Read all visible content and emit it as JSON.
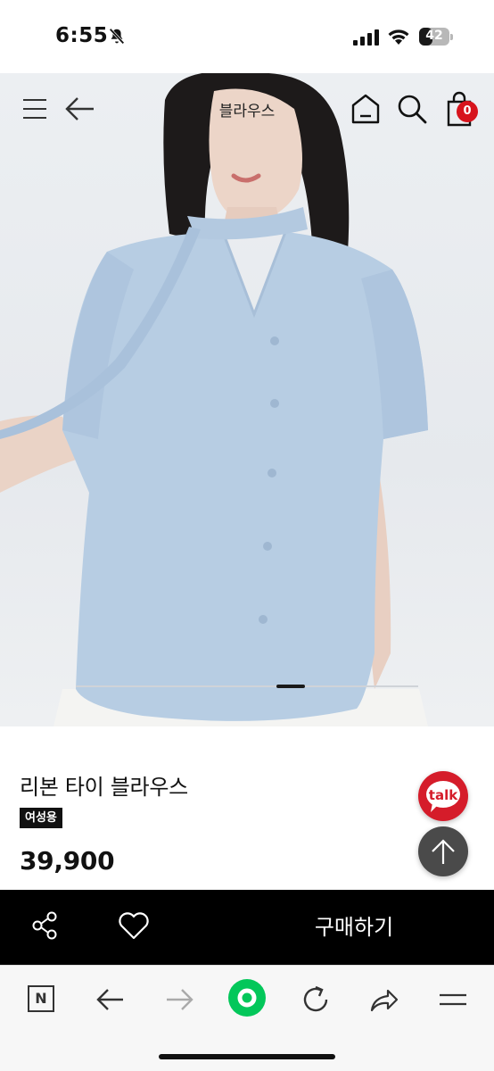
{
  "status_bar": {
    "time": "6:55",
    "battery": "42"
  },
  "header": {
    "title": "블라우스",
    "cart_count": "0"
  },
  "product": {
    "name": "리본 타이 블라우스",
    "badge": "여성용",
    "price": "39,900"
  },
  "floating": {
    "talk_label": "talk"
  },
  "buy_bar": {
    "buy_label": "구매하기"
  },
  "browser_bar": {
    "n_label": "N"
  },
  "colors": {
    "accent_red": "#d7141d",
    "buy_bar_bg": "#000000",
    "browser_green": "#03c75a"
  },
  "icons": [
    "bell-slash-icon",
    "signal-icon",
    "wifi-icon",
    "battery-icon",
    "menu-icon",
    "back-arrow-icon",
    "home-icon",
    "search-icon",
    "cart-icon",
    "talk-icon",
    "arrow-up-icon",
    "share-icon",
    "heart-icon",
    "n-icon",
    "browser-back-icon",
    "browser-forward-icon",
    "green-dot-icon",
    "refresh-icon",
    "share-arrow-icon",
    "hamburger-icon"
  ]
}
